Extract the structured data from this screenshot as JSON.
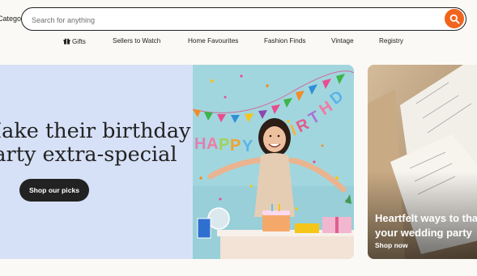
{
  "header": {
    "categories_label": "Categories",
    "search": {
      "placeholder": "Search for anything",
      "value": ""
    }
  },
  "nav": {
    "items": [
      "Gifts",
      "Sellers to Watch",
      "Home Favourites",
      "Fashion Finds",
      "Vintage",
      "Registry"
    ]
  },
  "hero": {
    "headline_line1": "Make their birthday",
    "headline_line2": "party extra-special",
    "button_label": "Shop our picks",
    "banner_letters": "HAPPY BIRTHDAY"
  },
  "side_card": {
    "title_line1": "Heartfelt ways to thank",
    "title_line2": "your wedding party",
    "link_label": "Shop now"
  },
  "colors": {
    "accent": "#f1641e",
    "hero_background": "#d6e1f7",
    "page_background": "#fbf9f5",
    "button_dark": "#222222"
  }
}
